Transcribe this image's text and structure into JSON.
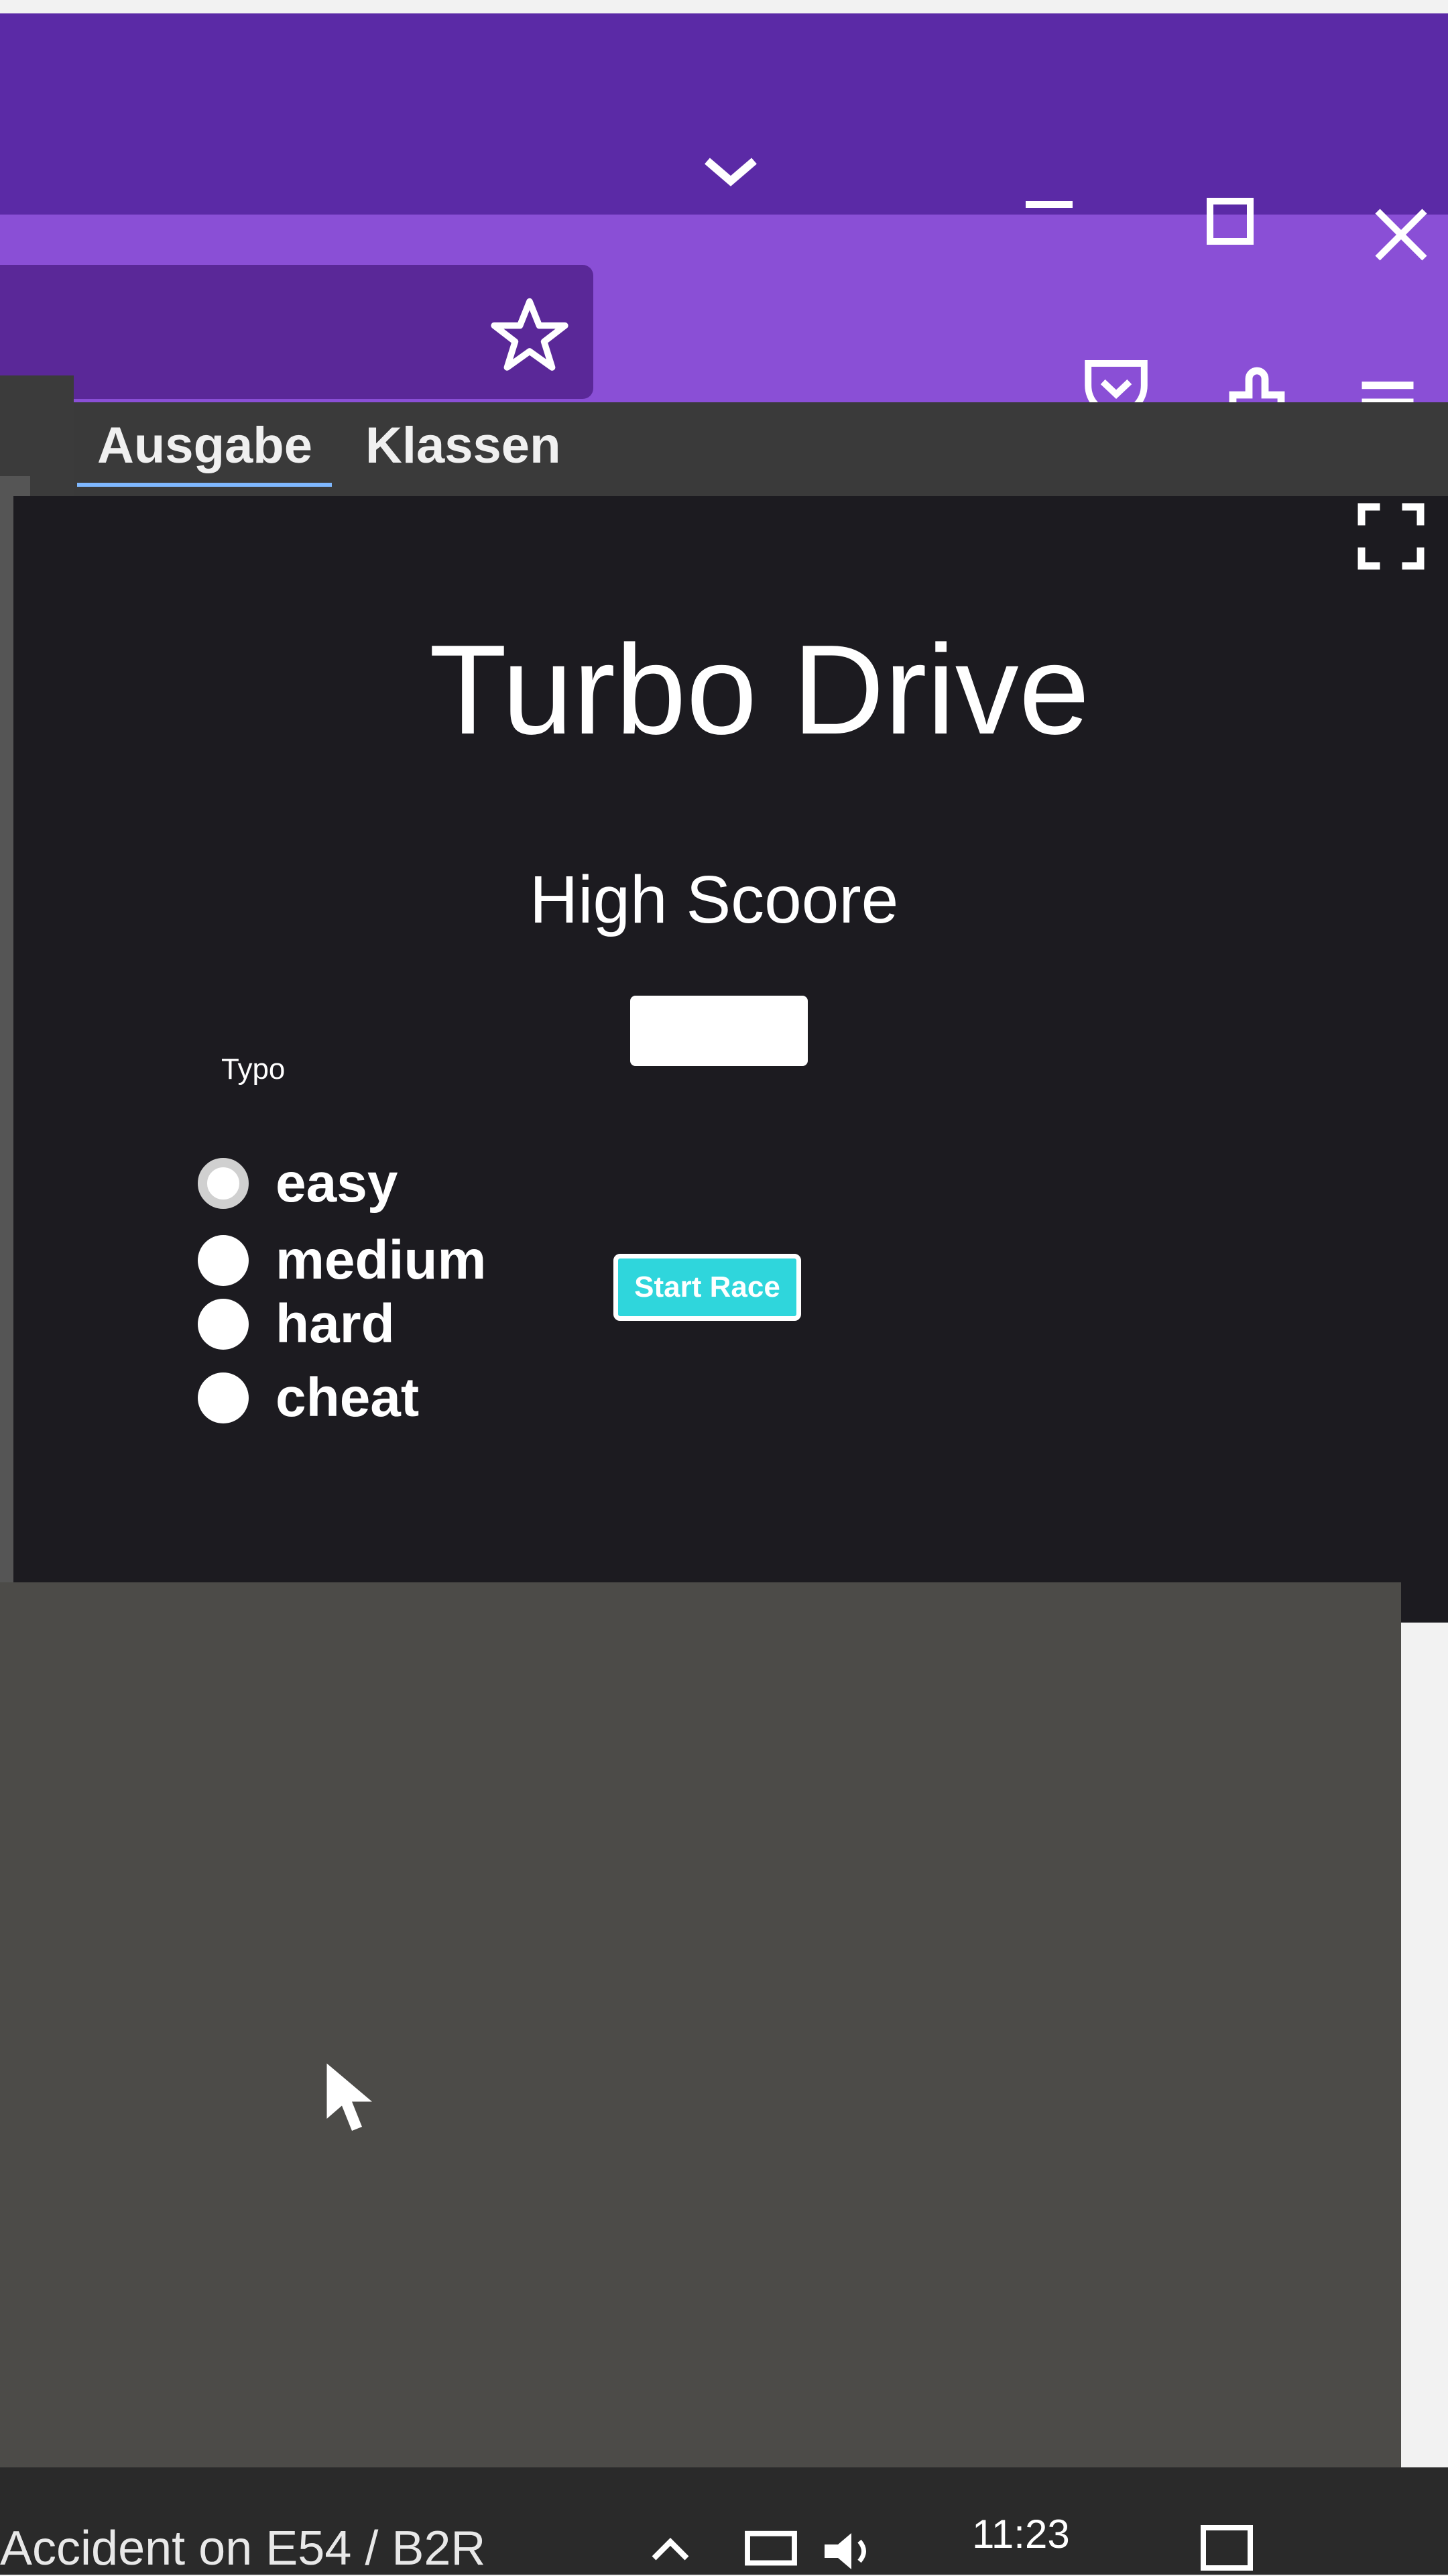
{
  "tabs": {
    "output": "Ausgabe",
    "classes": "Klassen"
  },
  "game": {
    "title": "Turbo Drive",
    "highscore_label": "High Scoore",
    "highscore_value": "",
    "difficulty_label": "Typo",
    "difficulties": [
      {
        "label": "easy",
        "selected": true
      },
      {
        "label": "medium",
        "selected": false
      },
      {
        "label": "hard",
        "selected": false
      },
      {
        "label": "cheat",
        "selected": false
      }
    ],
    "start_button": "Start Race"
  },
  "taskbar": {
    "news": "Accident on E54 / B2R",
    "clock": "11:23"
  },
  "colors": {
    "browser_frame": "#5b2aa6",
    "browser_toolbar": "#8a4fd6",
    "output_bg": "#1c1b20",
    "button_accent": "#2fd6dc"
  },
  "icons": [
    "chevron-down-icon",
    "minimize-icon",
    "maximize-icon",
    "close-icon",
    "star-icon",
    "pocket-icon",
    "extensions-icon",
    "menu-icon",
    "fullscreen-icon",
    "cursor-icon"
  ]
}
